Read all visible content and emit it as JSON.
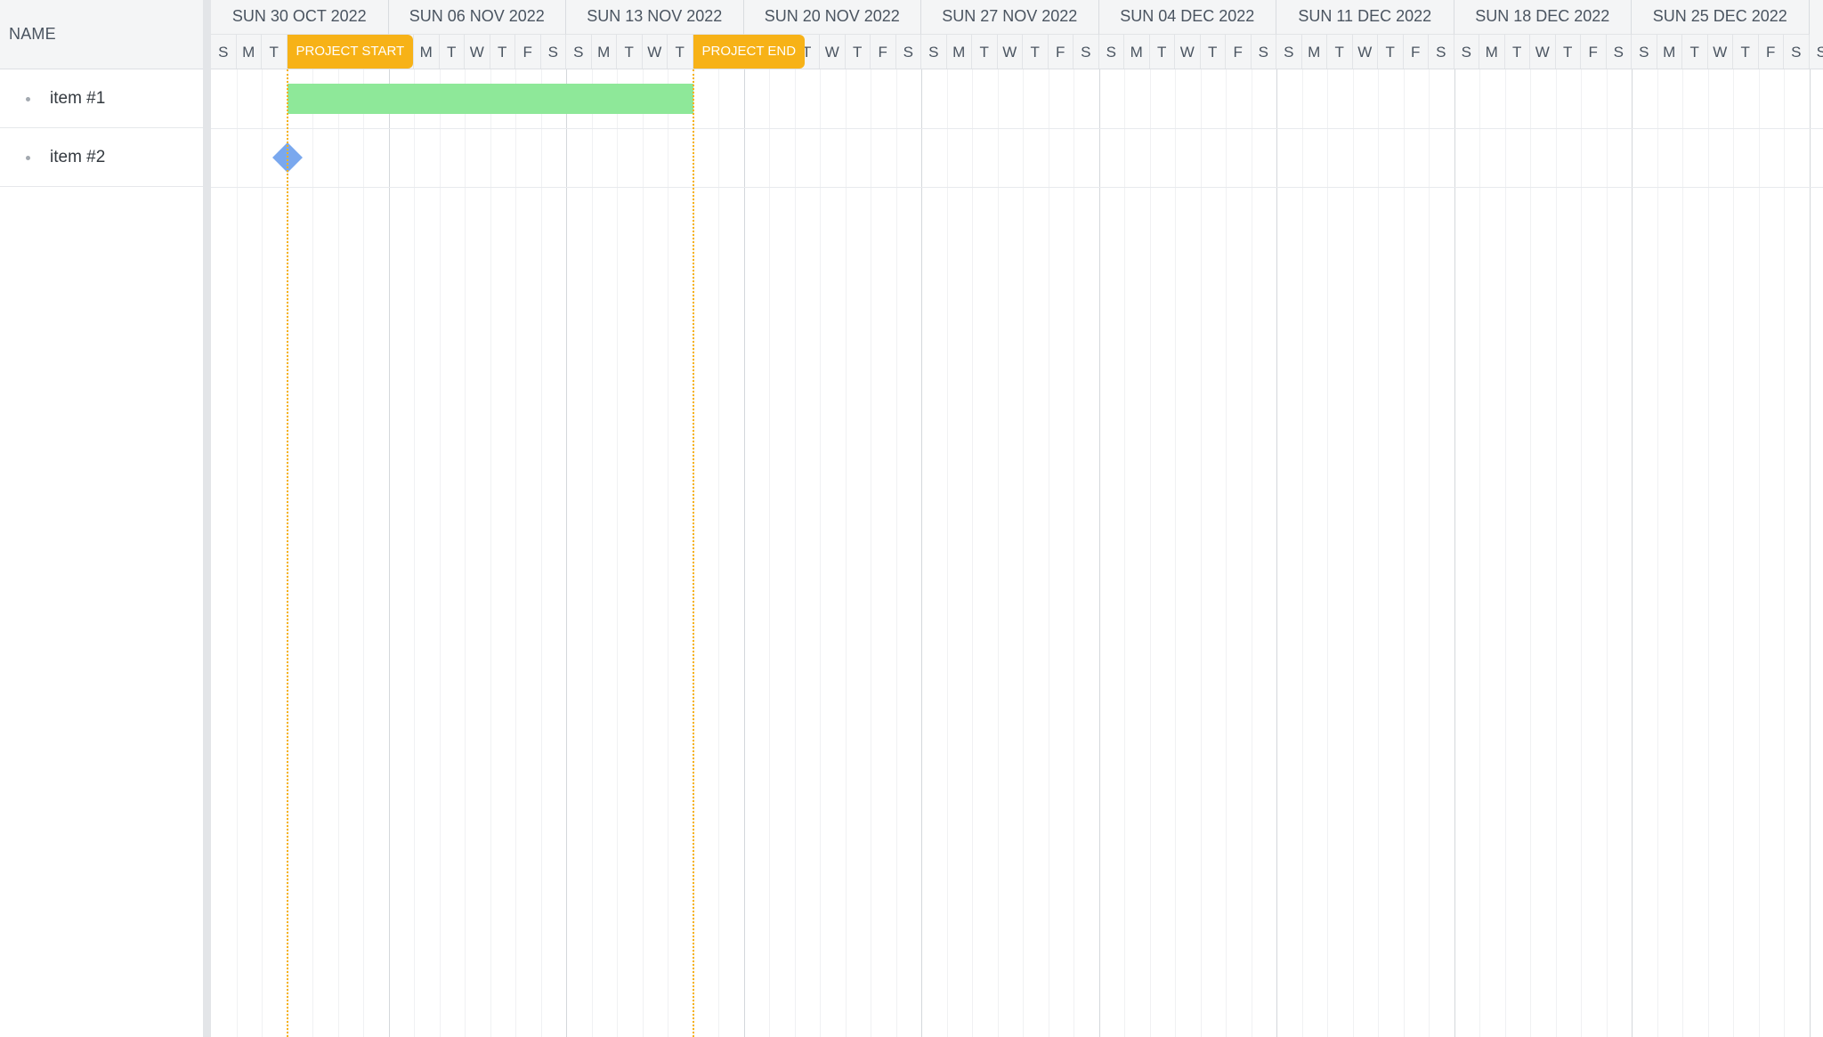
{
  "grid": {
    "column_header": "NAME",
    "rows": [
      {
        "label": "item #1"
      },
      {
        "label": "item #2"
      }
    ]
  },
  "timeline": {
    "weeks": [
      "SUN 30 OCT 2022",
      "SUN 06 NOV 2022",
      "SUN 13 NOV 2022",
      "SUN 20 NOV 2022",
      "SUN 27 NOV 2022",
      "SUN 04 DEC 2022",
      "SUN 11 DEC 2022",
      "SUN 18 DEC 2022",
      "SUN 25 DEC 2022"
    ],
    "day_letters": [
      "S",
      "M",
      "T",
      "W",
      "T",
      "F",
      "S"
    ]
  },
  "markers": {
    "start": {
      "label": "PROJECT START",
      "date": "2022-11-02"
    },
    "end": {
      "label": "PROJECT END",
      "date": "2022-11-18"
    }
  },
  "tasks": {
    "task1": {
      "name": "item #1",
      "start": "2022-11-02",
      "end": "2022-11-18",
      "color": "#8ee899"
    },
    "task2": {
      "name": "item #2",
      "milestone": "2022-11-02",
      "color": "#7aa8ee"
    }
  },
  "colors": {
    "marker": "#f7b217",
    "bar": "#8ee899",
    "milestone": "#7aa8ee"
  }
}
